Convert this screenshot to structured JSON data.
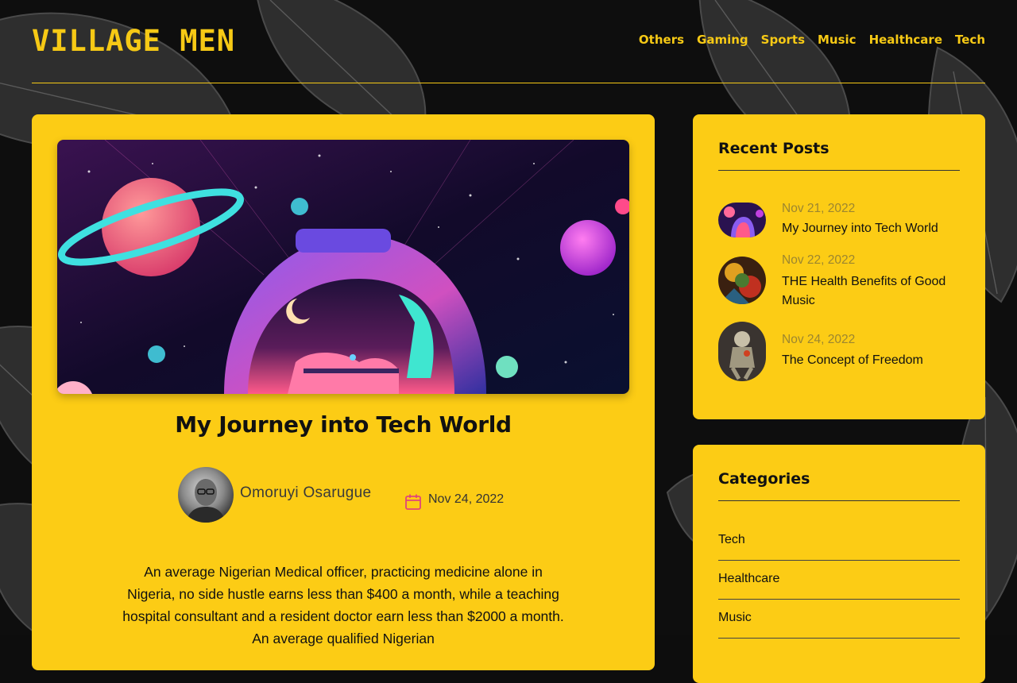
{
  "site": {
    "logo": "VILLAGE MEN"
  },
  "nav": {
    "items": [
      "Others",
      "Gaming",
      "Sports",
      "Music",
      "Healthcare",
      "Tech"
    ]
  },
  "post": {
    "title": "My Journey into Tech World",
    "author": "Omoruyi Osarugue",
    "date": "Nov 24, 2022",
    "body": "An average Nigerian Medical officer, practicing medicine alone in Nigeria, no side hustle earns less than $400 a month, while a teaching hospital consultant and a resident doctor earn less than $2000 a month. An average qualified Nigerian"
  },
  "recent_posts": {
    "title": "Recent Posts",
    "items": [
      {
        "date": "Nov 21, 2022",
        "title": "My Journey into Tech World"
      },
      {
        "date": "Nov 22, 2022",
        "title": "THE Health Benefits of Good Music"
      },
      {
        "date": "Nov 24, 2022",
        "title": "The Concept of Freedom"
      }
    ]
  },
  "categories": {
    "title": "Categories",
    "items": [
      "Tech",
      "Healthcare",
      "Music"
    ]
  },
  "colors": {
    "accent": "#fccc15",
    "nav_text": "#f6c915",
    "background": "#0d0d0d",
    "calendar_icon": "#e0457a"
  },
  "icons": {
    "calendar": "calendar-icon",
    "background": "monstera-leaf-pattern"
  }
}
